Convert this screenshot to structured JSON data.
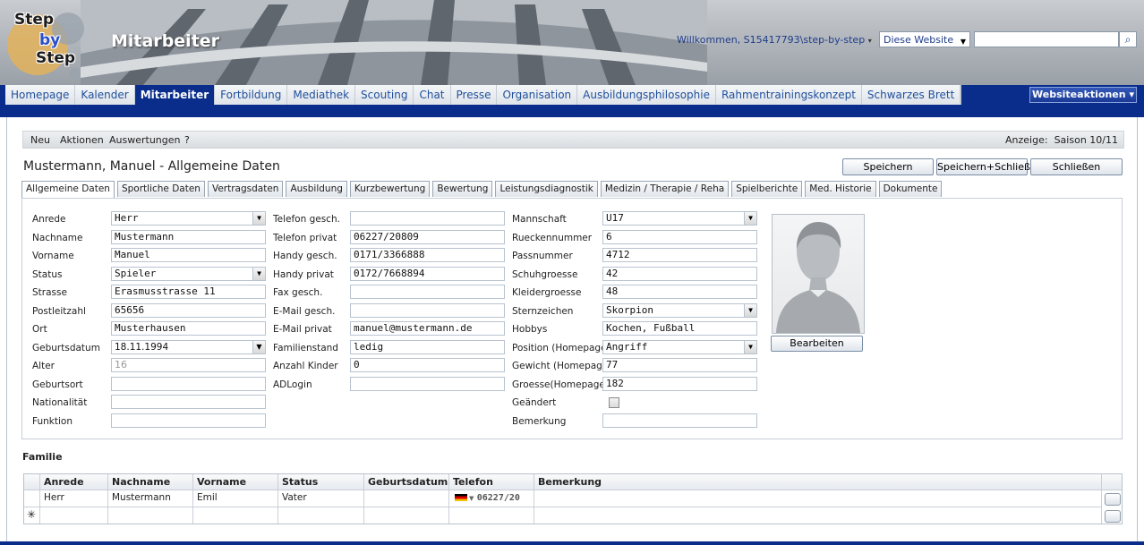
{
  "header": {
    "logo": {
      "line1": "Step",
      "line2": "by",
      "line3": "Step"
    },
    "site_title": "Mitarbeiter",
    "welcome": "Willkommen, S15417793\\step-by-step",
    "scope_select": "Diese Website",
    "search_placeholder": "",
    "search_icon": "magnifier-icon"
  },
  "nav": {
    "tabs": [
      "Homepage",
      "Kalender",
      "Mitarbeiter",
      "Fortbildung",
      "Mediathek",
      "Scouting",
      "Chat",
      "Presse",
      "Organisation",
      "Ausbildungsphilosophie",
      "Rahmentrainingskonzept",
      "Schwarzes Brett"
    ],
    "active": "Mitarbeiter",
    "site_actions": "Websiteaktionen"
  },
  "toolbar": {
    "items": [
      "Neu",
      "Aktionen",
      "Auswertungen",
      "?"
    ],
    "anzeige_label": "Anzeige:",
    "anzeige_value": "Saison 10/11"
  },
  "page": {
    "title": "Mustermann, Manuel - Allgemeine Daten",
    "buttons": {
      "save": "Speichern",
      "save_close": "Speichern+Schließen",
      "close": "Schließen"
    }
  },
  "tabs": [
    "Allgemeine Daten",
    "Sportliche Daten",
    "Vertragsdaten",
    "Ausbildung",
    "Kurzbewertung",
    "Bewertung",
    "Leistungsdiagnostik",
    "Medizin / Therapie / Reha",
    "Spielberichte",
    "Med. Historie",
    "Dokumente"
  ],
  "form": {
    "col1": [
      {
        "label": "Anrede",
        "value": "Herr",
        "select": true
      },
      {
        "label": "Nachname",
        "value": "Mustermann"
      },
      {
        "label": "Vorname",
        "value": "Manuel"
      },
      {
        "label": "Status",
        "value": "Spieler",
        "select": true
      },
      {
        "label": "Strasse",
        "value": "Erasmusstrasse 11"
      },
      {
        "label": "Postleitzahl",
        "value": "65656"
      },
      {
        "label": "Ort",
        "value": "Musterhausen"
      },
      {
        "label": "Geburtsdatum",
        "value": "18.11.1994",
        "select": true
      },
      {
        "label": "Alter",
        "value": "16"
      },
      {
        "label": "Geburtsort",
        "value": ""
      },
      {
        "label": "Nationalität",
        "value": ""
      },
      {
        "label": "Funktion",
        "value": ""
      }
    ],
    "col2": [
      {
        "label": "Telefon gesch.",
        "value": ""
      },
      {
        "label": "Telefon privat",
        "value": "06227/20809"
      },
      {
        "label": "Handy gesch.",
        "value": "0171/3366888"
      },
      {
        "label": "Handy privat",
        "value": "0172/7668894"
      },
      {
        "label": "Fax gesch.",
        "value": ""
      },
      {
        "label": "E-Mail gesch.",
        "value": ""
      },
      {
        "label": "E-Mail privat",
        "value": "manuel@mustermann.de"
      },
      {
        "label": "Familienstand",
        "value": "ledig"
      },
      {
        "label": "Anzahl Kinder",
        "value": "0"
      },
      {
        "label": "ADLogin",
        "value": ""
      }
    ],
    "col3": [
      {
        "label": "Mannschaft",
        "value": "U17",
        "select": true
      },
      {
        "label": "Rueckennummer",
        "value": "6"
      },
      {
        "label": "Passnummer",
        "value": "4712"
      },
      {
        "label": "Schuhgroesse",
        "value": "42"
      },
      {
        "label": "Kleidergroesse",
        "value": "48"
      },
      {
        "label": "Sternzeichen",
        "value": "Skorpion",
        "select": true
      },
      {
        "label": "Hobbys",
        "value": "Kochen, Fußball"
      },
      {
        "label": "Position (Homepage)",
        "value": "Angriff",
        "select": true
      },
      {
        "label": "Gewicht (Homepage)",
        "value": "77"
      },
      {
        "label": "Groesse(Homepage)",
        "value": "182"
      },
      {
        "label": "Geändert",
        "value": "",
        "checkbox": true
      },
      {
        "label": "Bemerkung",
        "value": ""
      }
    ],
    "photo_button": "Bearbeiten"
  },
  "family": {
    "label": "Familie",
    "columns": [
      "Anrede",
      "Nachname",
      "Vorname",
      "Status",
      "Geburtsdatum",
      "Telefon",
      "Bemerkung"
    ],
    "rows": [
      [
        "Herr",
        "Mustermann",
        "Emil",
        "Vater",
        "",
        "06227/20",
        ""
      ]
    ],
    "new_row_marker": "✳"
  }
}
